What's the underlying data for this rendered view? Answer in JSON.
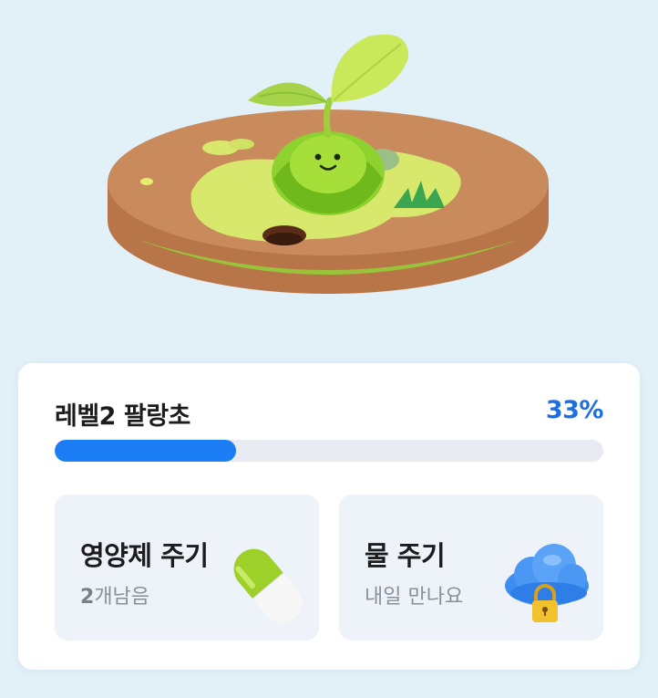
{
  "progress": {
    "title": "레벨2 팔랑초",
    "percent_label": "33%",
    "value": 0.33,
    "fill_color": "#1b7ef5",
    "track_color": "#e9ebf2"
  },
  "actions": [
    {
      "title": "영양제 주기",
      "subtitle_count": "2",
      "subtitle_rest": "개남음",
      "icon": "capsule-icon"
    },
    {
      "title": "물 주기",
      "subtitle": "내일 만나요",
      "icon": "locked-cloud-icon"
    }
  ],
  "colors": {
    "background": "#e2f0f8",
    "accent": "#1f6fe0"
  }
}
